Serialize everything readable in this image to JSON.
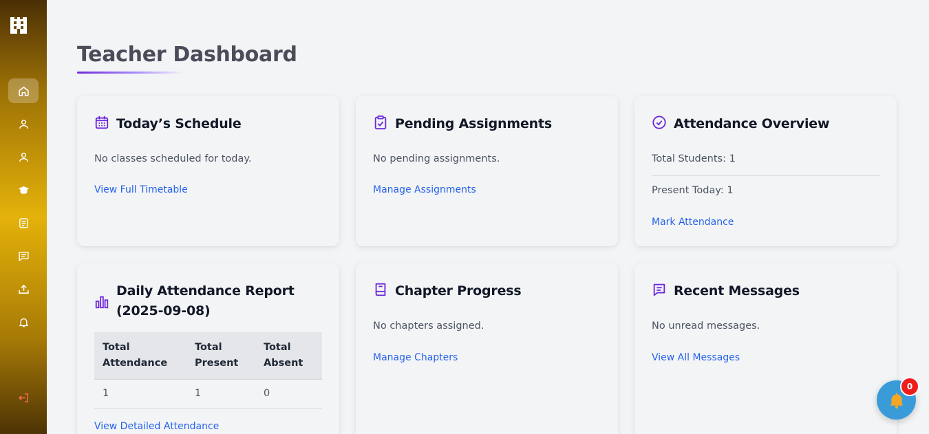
{
  "sidebar": {
    "logo_icon": "building-icon",
    "items": [
      {
        "name": "home",
        "icon": "home-icon",
        "active": true
      },
      {
        "name": "profile",
        "icon": "user-icon"
      },
      {
        "name": "students",
        "icon": "user-icon"
      },
      {
        "name": "classes",
        "icon": "graduation-cap-icon"
      },
      {
        "name": "assignments",
        "icon": "document-icon"
      },
      {
        "name": "messages",
        "icon": "chat-icon"
      },
      {
        "name": "uploads",
        "icon": "upload-icon"
      },
      {
        "name": "notifications",
        "icon": "bell-icon"
      }
    ],
    "logout_icon": "logout-icon"
  },
  "page": {
    "title": "Teacher Dashboard"
  },
  "schedule": {
    "title": "Today’s Schedule",
    "text": "No classes scheduled for today.",
    "link": "View Full Timetable",
    "icon": "calendar-icon"
  },
  "assignments": {
    "title": "Pending Assignments",
    "text": "No pending assignments.",
    "link": "Manage Assignments",
    "icon": "clipboard-check-icon"
  },
  "attendance": {
    "title": "Attendance Overview",
    "total_students": "Total Students: 1",
    "present_today": "Present Today: 1",
    "link": "Mark Attendance",
    "icon": "check-circle-icon"
  },
  "report": {
    "title": "Daily Attendance Report (2025-09-08)",
    "icon": "bar-chart-icon",
    "headers": [
      "Total Attendance",
      "Total Present",
      "Total Absent"
    ],
    "rows": [
      [
        "1",
        "1",
        "0"
      ]
    ],
    "link": "View Detailed Attendance"
  },
  "chapters": {
    "title": "Chapter Progress",
    "text": "No chapters assigned.",
    "link": "Manage Chapters",
    "icon": "book-icon"
  },
  "messages": {
    "title": "Recent Messages",
    "text": "No unread messages.",
    "link": "View All Messages",
    "icon": "message-icon"
  },
  "notification": {
    "count": "0",
    "icon": "bell-icon"
  },
  "colors": {
    "accent": "#6d28d9",
    "link": "#2563eb",
    "badge": "#ef1c1c",
    "notif_button": "#3a9bd9"
  }
}
